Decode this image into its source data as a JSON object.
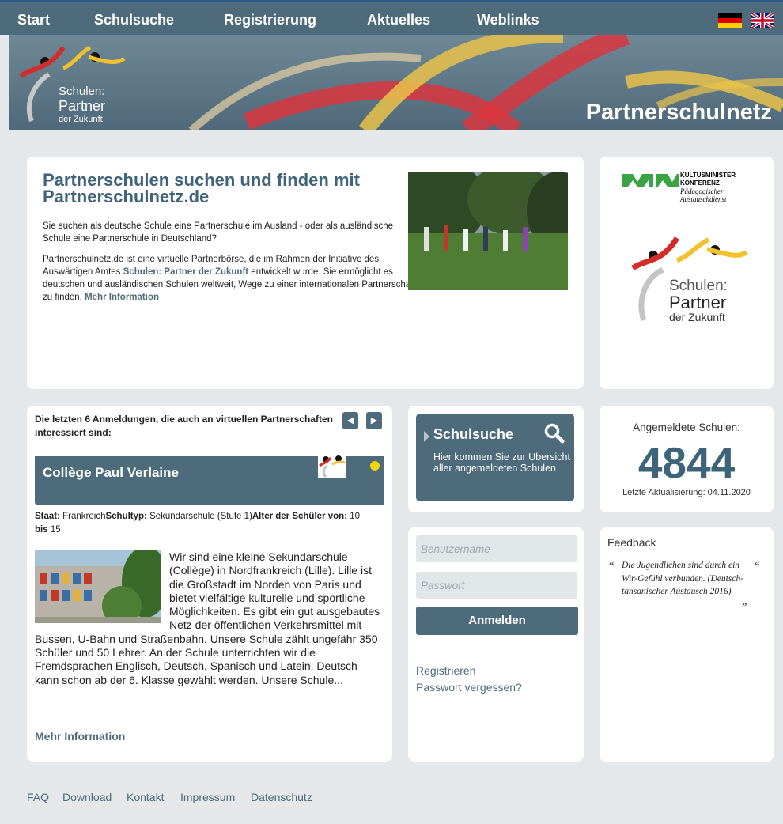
{
  "nav": {
    "items": [
      {
        "label": "Start"
      },
      {
        "label": "Schulsuche"
      },
      {
        "label": "Registrierung"
      },
      {
        "label": "Aktuelles"
      },
      {
        "label": "Weblinks"
      }
    ]
  },
  "banner": {
    "logo_line1": "Schulen:",
    "logo_line2": "Partner",
    "logo_line3": "der Zukunft",
    "title": "Partnerschulnetz"
  },
  "intro": {
    "title": "Partnerschulen suchen und finden mit Partnerschulnetz.de",
    "p1": "Sie suchen als deutsche Schule eine Partnerschule im Ausland - oder als ausländische Schule eine Partnerschule in Deutschland?",
    "p2_a": "Partnerschulnetz.de ist eine virtuelle Partnerbörse, die im Rahmen der Initiative des Auswärtigen Amtes ",
    "p2_link": "Schulen: Partner der Zukunft",
    "p2_b": " entwickelt wurde. Sie ermöglicht es deutschen und ausländischen Schulen weltweit, Wege zu einer internationalen Partnerschaft zu finden. ",
    "p2_more": "Mehr Information"
  },
  "kmk": {
    "line1": "KULTUSMINISTER",
    "line2": "KONFERENZ",
    "line3": "Pädagogischer",
    "line4": "Austauschdienst",
    "logo_line1": "Schulen:",
    "logo_line2": "Partner",
    "logo_line3": "der Zukunft"
  },
  "latest": {
    "title": "Die letzten 6 Anmeldungen, die auch an virtuellen Partnerschaften interessiert sind:",
    "school_name": "Collège Paul Verlaine",
    "staat_label": "Staat:",
    "staat": "Frankreich",
    "schultyp_label": "Schultyp:",
    "schultyp": "Sekundarschule (Stufe 1)",
    "alter_label": "Alter der Schüler von:",
    "alter_von": "10",
    "bis_label": "bis",
    "alter_bis": "15",
    "description": "Wir sind eine kleine Sekundarschule (Collège) in Nordfrankreich (Lille). Lille ist die Großstadt im Norden von Paris und bietet vielfältige kulturelle und sportliche Möglichkeiten. Es gibt ein gut ausgebautes Netz der öffentlichen Verkehrsmittel mit Bussen, U-Bahn und Straßenbahn. Unsere Schule zählt ungefähr 350 Schüler und 50 Lehrer. An der Schule unterrichten wir die Fremdsprachen Englisch, Deutsch, Spanisch und Latein. Deutsch kann schon ab der 6. Klasse gewählt werden. Unsere Schule...",
    "more": "Mehr Information"
  },
  "search": {
    "title": "Schulsuche",
    "description": "Hier kommen Sie zur Übersicht aller angemeldeten Schulen"
  },
  "stats": {
    "label": "Angemeldete Schulen:",
    "count": "4844",
    "updated": "Letzte Aktualisierung: 04.11.2020"
  },
  "login": {
    "username_placeholder": "Benutzername",
    "password_placeholder": "Passwort",
    "button": "Anmelden",
    "register": "Registrieren",
    "forgot": "Passwort vergessen?"
  },
  "feedback": {
    "title": "Feedback",
    "quote": "Die Jugendlichen sind durch ein Wir-Gefühl verbunden. (Deutsch-tansanischer Austausch 2016)"
  },
  "footer": {
    "links": [
      "FAQ",
      "Download",
      "Kontakt",
      "Impressum",
      "Datenschutz"
    ]
  },
  "colors": {
    "primary": "#4d6b7b",
    "heading": "#3e6479",
    "background": "#e4e8ea",
    "logo_red": "#d42b2b",
    "logo_yellow": "#f2c12e"
  }
}
